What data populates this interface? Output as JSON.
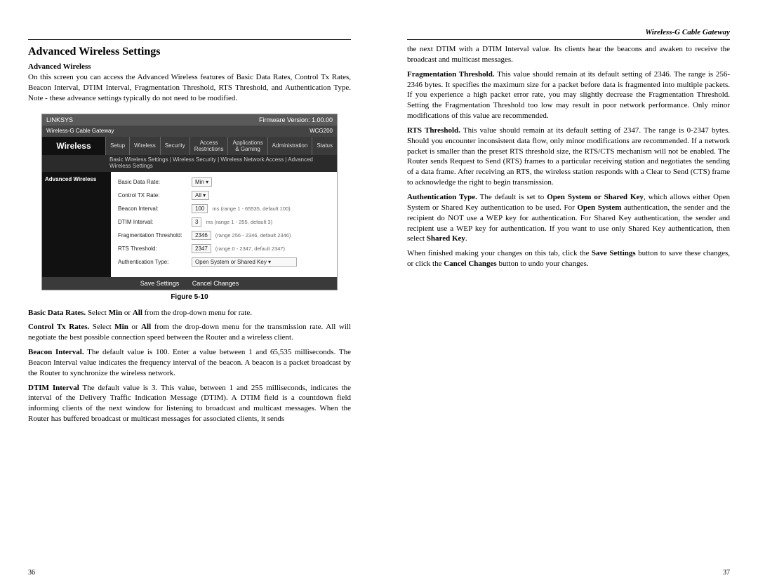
{
  "doc_header": "Wireless-G Cable Gateway",
  "page_numbers": {
    "left": "36",
    "right": "37"
  },
  "left": {
    "section_title": "Advanced Wireless Settings",
    "sub_title": "Advanced Wireless",
    "intro": "On this screen you can access the Advanced Wireless features of Basic Data Rates, Control Tx Rates, Beacon Interval, DTIM Interval, Fragmentation Threshold, RTS Threshold, and Authentication Type. Note - these adveance settings typically do not need to be modified.",
    "figure_caption": "Figure 5-10",
    "basic_data_rates": {
      "label": "Basic Data Rates.",
      "text_a": " Select ",
      "min": "Min",
      "text_b": " or ",
      "all": "All",
      "text_c": " from the drop-down menu for rate."
    },
    "control_tx_rates": {
      "label": "Control Tx Rates.",
      "text_a": " Select ",
      "min": "Min",
      "text_b": " or ",
      "all": "All",
      "text_c": " from the drop-down menu for the transmission rate. All will negotiate the best possible connection speed between the Router and a wireless client."
    },
    "beacon_interval": {
      "label": "Beacon Interval.",
      "text": " The default value is 100. Enter a value between 1 and 65,535 milliseconds. The Beacon Interval value indicates the frequency interval of the beacon. A beacon is a packet broadcast by the Router to synchronize the wireless network."
    },
    "dtim_interval": {
      "label": "DTIM Interval",
      "text": " The default value is 3. This value, between 1 and 255 milliseconds, indicates the interval of the Delivery Traffic Indication Message (DTIM). A DTIM field is a countdown field informing clients of the next window for listening to broadcast and multicast messages. When the Router has buffered broadcast or multicast messages for associated clients, it sends"
    }
  },
  "right": {
    "continuation": "the next DTIM with a DTIM Interval value. Its clients hear the beacons and awaken to receive the broadcast and multicast messages.",
    "frag": {
      "label": "Fragmentation Threshold.",
      "text": " This value should remain at its default setting of 2346. The range is 256-2346 bytes. It specifies the maximum size for a packet before data is fragmented into multiple packets. If you experience a high packet error rate, you may slightly decrease the Fragmentation Threshold. Setting the Fragmentation Threshold too low may result in poor network performance. Only minor modifications of this value are recommended."
    },
    "rts": {
      "label": "RTS Threshold.",
      "text": " This value should remain at its default setting of 2347. The range is 0-2347 bytes. Should you encounter inconsistent data flow, only minor modifications are recommended. If a network packet is smaller than the preset RTS threshold size, the RTS/CTS mechanism will not be enabled. The Router sends Request to Send (RTS) frames to a particular receiving station and negotiates the sending of a data frame. After receiving an RTS, the wireless station responds with a Clear to Send (CTS) frame to acknowledge the right to begin transmission."
    },
    "auth": {
      "label": "Authentication Type.",
      "text_a": " The default is set to ",
      "opensystem_or_shared": "Open System or Shared Key",
      "text_b": ", which allows either Open System or Shared Key authentication to be used. For ",
      "opensystem": "Open System",
      "text_c": " authentication, the sender and the recipient do NOT use a WEP key for authentication. For Shared Key authentication, the sender and recipient use a WEP key for authentication. If you want to use only Shared Key authentication, then select ",
      "sharedkey": "Shared Key",
      "period": "."
    },
    "save": {
      "text_a": "When finished making your changes on this tab, click the ",
      "save_btn": "Save Settings",
      "text_b": " button to save these changes, or click the ",
      "cancel_btn": "Cancel Changes",
      "text_c": " button to undo your changes."
    }
  },
  "router_ui": {
    "brand": "LINKSYS",
    "firmware": "Firmware Version: 1.00.00",
    "model_line": "Wireless-G Cable Gateway",
    "model_code": "WCG200",
    "section_label": "Wireless",
    "tabs": [
      "Setup",
      "Wireless",
      "Security",
      "Access Restrictions",
      "Applications & Gaming",
      "Administration",
      "Status"
    ],
    "subnav": "Basic Wireless Settings  |  Wireless Security  |  Wireless Network Access  |  Advanced Wireless Settings",
    "side_label": "Advanced Wireless",
    "rows": {
      "basic_rate": {
        "label": "Basic Data Rate:",
        "value": "Min ▾"
      },
      "control_tx": {
        "label": "Control TX Rate:",
        "value": "All ▾"
      },
      "beacon": {
        "label": "Beacon Interval:",
        "value": "100",
        "hint": "ms (range 1 - 65535, default 100)"
      },
      "dtim": {
        "label": "DTIM Interval:",
        "value": "3",
        "hint": "ms (range 1 - 255, default 3)"
      },
      "frag": {
        "label": "Fragmentation Threshold:",
        "value": "2346",
        "hint": "(range 256 - 2346, default 2346)"
      },
      "rts": {
        "label": "RTS Threshold:",
        "value": "2347",
        "hint": "(range 0 - 2347, default 2347)"
      },
      "auth": {
        "label": "Authentication Type:",
        "value": "Open System or Shared Key ▾"
      }
    },
    "footer": {
      "save": "Save Settings",
      "cancel": "Cancel Changes"
    }
  }
}
